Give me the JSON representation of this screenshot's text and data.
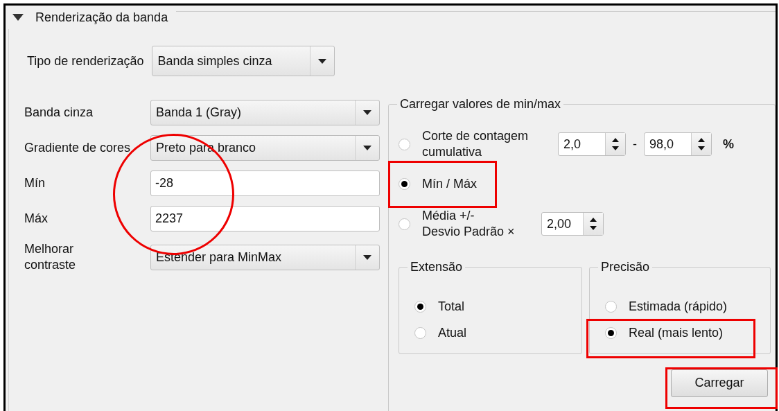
{
  "section": {
    "title": "Renderização da banda",
    "expanded": true
  },
  "render_type": {
    "label": "Tipo de renderização",
    "value": "Banda simples cinza"
  },
  "fields": [
    {
      "kind": "combo",
      "label": "Banda cinza",
      "value": "Banda 1 (Gray)"
    },
    {
      "kind": "combo",
      "label": "Gradiente de cores",
      "value": "Preto para branco"
    },
    {
      "kind": "text",
      "label": "Mín",
      "value": "-28"
    },
    {
      "kind": "text",
      "label": "Máx",
      "value": "2237"
    },
    {
      "kind": "combo",
      "label": "Melhorar\ncontraste",
      "value": "Estender para MinMax"
    }
  ],
  "minmax": {
    "title": "Carregar valores de min/max",
    "options": [
      {
        "kind": "cumulative",
        "label": "Corte de contagem\ncumulativa",
        "selected": false,
        "from": "2,0",
        "separator": "-",
        "to": "98,0",
        "unit": "%"
      },
      {
        "kind": "minmax",
        "label": "Mín / Máx",
        "selected": true
      },
      {
        "kind": "stddev",
        "label": "Média +/-\nDesvio Padrão ×",
        "selected": false,
        "factor": "2,00"
      }
    ],
    "extent": {
      "title": "Extensão",
      "options": [
        {
          "label": "Total",
          "selected": true
        },
        {
          "label": "Atual",
          "selected": false
        }
      ]
    },
    "accuracy": {
      "title": "Precisão",
      "options": [
        {
          "label": "Estimada (rápido)",
          "selected": false
        },
        {
          "label": "Real (mais lento)",
          "selected": true
        }
      ]
    },
    "load_button": "Carregar"
  },
  "highlights": [
    {
      "kind": "circle"
    },
    {
      "kind": "rect"
    },
    {
      "kind": "rect"
    },
    {
      "kind": "rect"
    }
  ]
}
